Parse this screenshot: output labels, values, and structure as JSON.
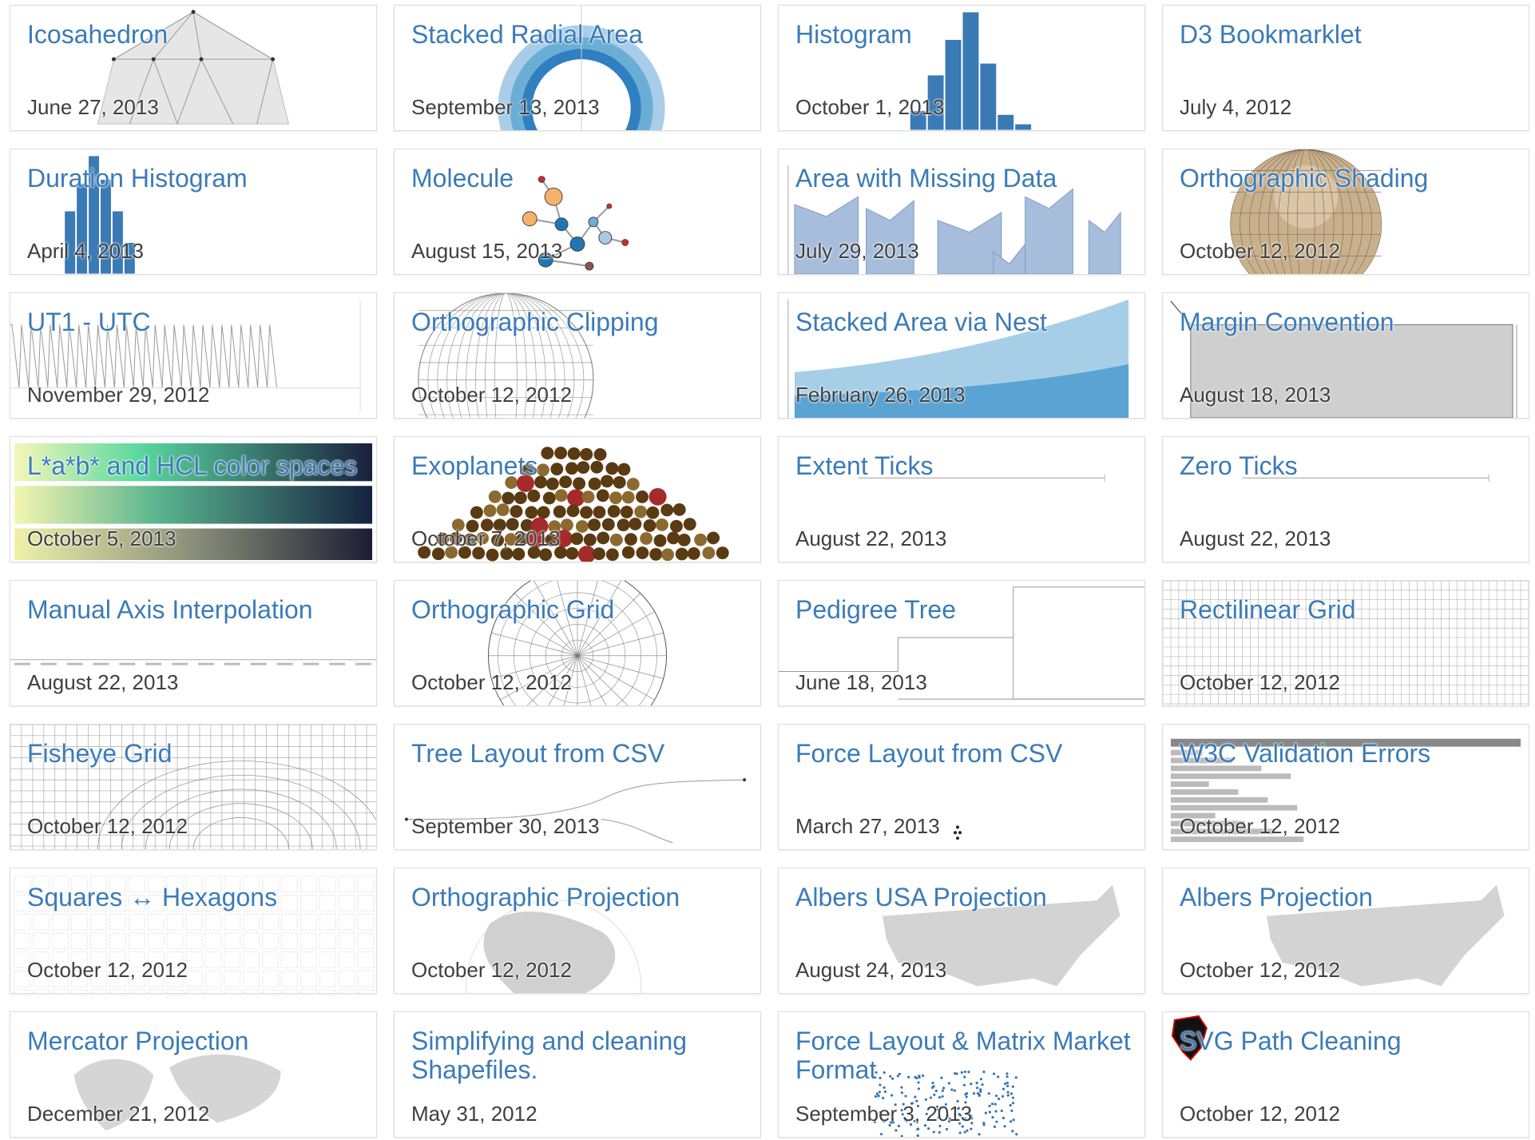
{
  "colors": {
    "title": "#3b7bb8",
    "date": "#3f3f3f",
    "card_border": "#dddddd"
  },
  "gallery": {
    "items": [
      {
        "title": "Icosahedron",
        "date": "June 27, 2013",
        "thumb": "icosahedron"
      },
      {
        "title": "Stacked Radial Area",
        "date": "September 13, 2013",
        "thumb": "radial-area"
      },
      {
        "title": "Histogram",
        "date": "October 1, 2013",
        "thumb": "histogram"
      },
      {
        "title": "D3 Bookmarklet",
        "date": "July 4, 2012",
        "thumb": "none"
      },
      {
        "title": "Duration Histogram",
        "date": "April 4, 2013",
        "thumb": "duration-histogram"
      },
      {
        "title": "Molecule",
        "date": "August 15, 2013",
        "thumb": "molecule"
      },
      {
        "title": "Area with Missing Data",
        "date": "July 29, 2013",
        "thumb": "area-missing"
      },
      {
        "title": "Orthographic Shading",
        "date": "October 12, 2012",
        "thumb": "shaded-globe"
      },
      {
        "title": "UT1 - UTC",
        "date": "November 29, 2012",
        "thumb": "sawtooth"
      },
      {
        "title": "Orthographic Clipping",
        "date": "October 12, 2012",
        "thumb": "globe-grid"
      },
      {
        "title": "Stacked Area via Nest",
        "date": "February 26, 2013",
        "thumb": "stacked-area"
      },
      {
        "title": "Margin Convention",
        "date": "August 18, 2013",
        "thumb": "margin"
      },
      {
        "title": "L*a*b* and HCL color spaces",
        "date": "October 5, 2013",
        "thumb": "color-ramps"
      },
      {
        "title": "Exoplanets",
        "date": "October 7, 2013",
        "thumb": "exoplanets"
      },
      {
        "title": "Extent Ticks",
        "date": "August 22, 2013",
        "thumb": "axis-line"
      },
      {
        "title": "Zero Ticks",
        "date": "August 22, 2013",
        "thumb": "axis-line"
      },
      {
        "title": "Manual Axis Interpolation",
        "date": "August 22, 2013",
        "thumb": "axis-bottom"
      },
      {
        "title": "Orthographic Grid",
        "date": "October 12, 2012",
        "thumb": "globe-grid-dense"
      },
      {
        "title": "Pedigree Tree",
        "date": "June 18, 2013",
        "thumb": "pedigree"
      },
      {
        "title": "Rectilinear Grid",
        "date": "October 12, 2012",
        "thumb": "rect-grid"
      },
      {
        "title": "Fisheye Grid",
        "date": "October 12, 2012",
        "thumb": "fisheye"
      },
      {
        "title": "Tree Layout from CSV",
        "date": "September 30, 2013",
        "thumb": "tree"
      },
      {
        "title": "Force Layout from CSV",
        "date": "March 27, 2013",
        "thumb": "force-dots"
      },
      {
        "title": "W3C Validation Errors",
        "date": "October 12, 2012",
        "thumb": "bars"
      },
      {
        "title": "Squares ↔ Hexagons",
        "date": "October 12, 2012",
        "thumb": "hex"
      },
      {
        "title": "Orthographic Projection",
        "date": "October 12, 2012",
        "thumb": "globe-land"
      },
      {
        "title": "Albers USA Projection",
        "date": "August 24, 2013",
        "thumb": "usa"
      },
      {
        "title": "Albers Projection",
        "date": "October 12, 2012",
        "thumb": "usa"
      },
      {
        "title": "Mercator Projection",
        "date": "December 21, 2012",
        "thumb": "world"
      },
      {
        "title": "Simplifying and cleaning Shapefiles.",
        "date": "May 31, 2012",
        "thumb": "none"
      },
      {
        "title": "Force Layout & Matrix Market Format",
        "date": "September 3, 2013",
        "thumb": "matrix-dots"
      },
      {
        "title": "SVG Path Cleaning",
        "date": "October 12, 2012",
        "thumb": "black-blob"
      }
    ]
  }
}
